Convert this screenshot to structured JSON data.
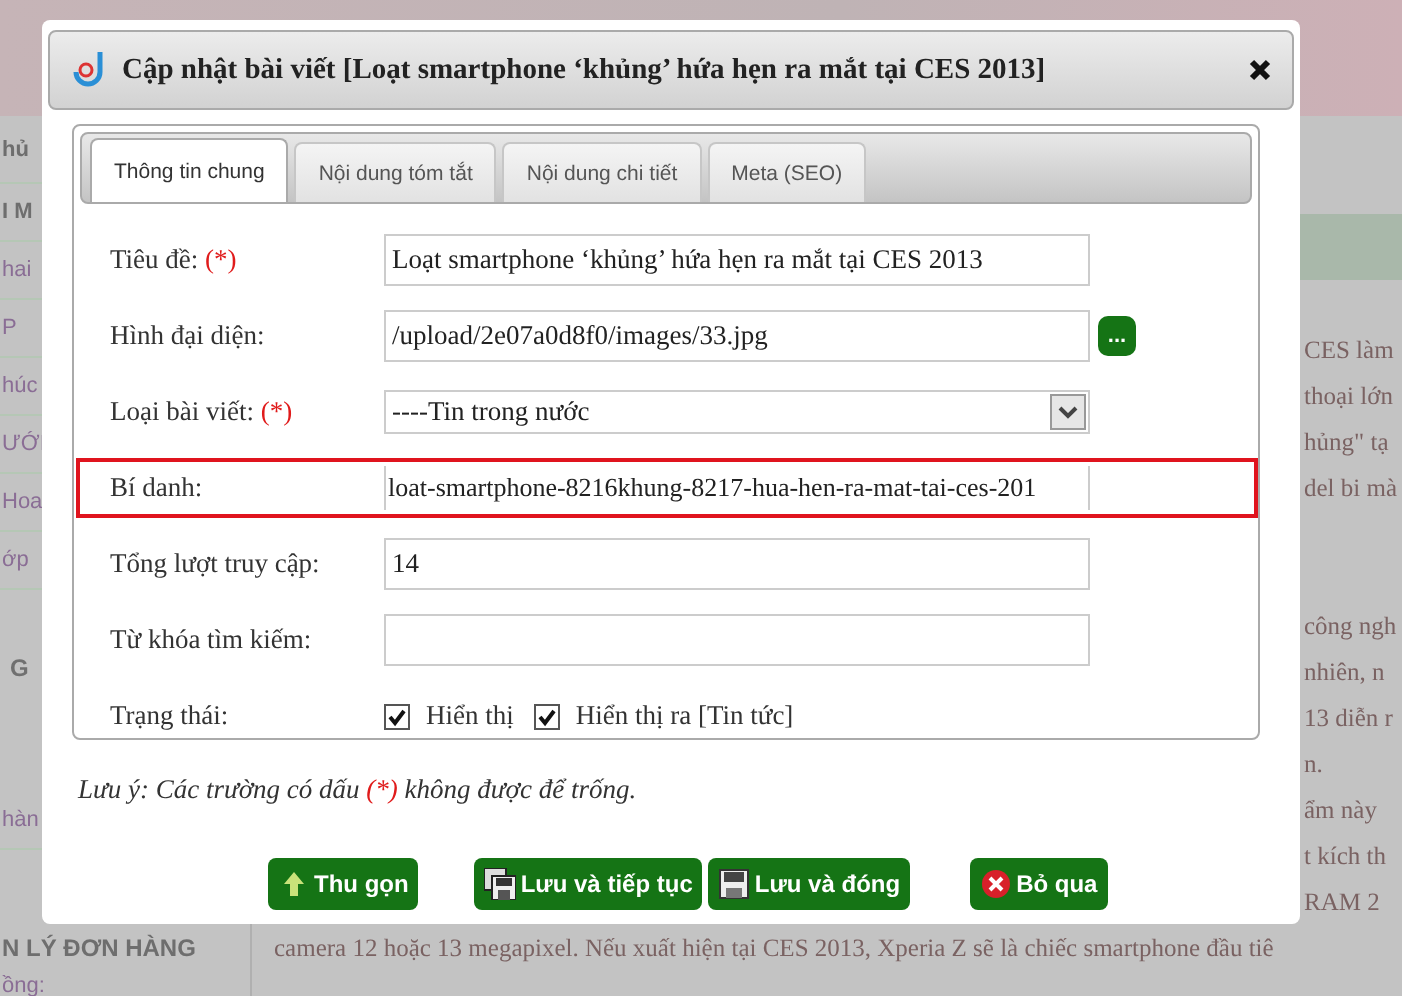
{
  "background": {
    "sidebar": [
      {
        "kind": "heading",
        "text": "hủ"
      },
      {
        "kind": "heading",
        "text": "I M"
      },
      {
        "kind": "link",
        "text": "hai"
      },
      {
        "kind": "link",
        "text": "P"
      },
      {
        "kind": "link",
        "text": "húc"
      },
      {
        "kind": "link",
        "text": "ƯỚI"
      },
      {
        "kind": "link",
        "text": "Hoa"
      },
      {
        "kind": "link",
        "text": "ớp"
      },
      {
        "kind": "section",
        "text": "G"
      },
      {
        "kind": "link",
        "text": "hàn"
      },
      {
        "kind": "heading",
        "text": "N LÝ ĐƠN HÀNG"
      },
      {
        "kind": "link",
        "text": "ồng:"
      }
    ],
    "paragraphs": [
      {
        "lines": [
          "CES làm",
          "thoại lớn",
          "hủng\" tạ",
          "del bi mà"
        ]
      },
      {
        "lines": [
          "công ngh",
          "nhiên, n",
          "13 diễn r",
          "n.",
          "ẩm này",
          "t kích th",
          "RAM 2"
        ]
      }
    ],
    "last_line": "camera 12 hoặc 13 megapixel. Nếu xuất hiện tại CES 2013, Xperia Z sẽ là chiếc smartphone đầu tiê"
  },
  "dialog": {
    "title": "Cập nhật bài viết [Loạt smartphone ‘khủng’ hứa hẹn ra mắt tại CES 2013]",
    "tabs": [
      {
        "label": "Thông tin chung",
        "selected": true
      },
      {
        "label": "Nội dung tóm tắt",
        "selected": false
      },
      {
        "label": "Nội dung chi tiết",
        "selected": false
      },
      {
        "label": "Meta (SEO)",
        "selected": false
      }
    ],
    "rows": [
      {
        "kind": "text",
        "label": "Tiêu đề:",
        "required_mark": "(*)",
        "value": "Loạt smartphone ‘khủng’ hứa hẹn ra mắt tại CES 2013",
        "highlighted": false
      },
      {
        "kind": "file",
        "label": "Hình đại diện:",
        "value": "/upload/2e07a0d8f0/images/33.jpg",
        "button": "...",
        "highlighted": false
      },
      {
        "kind": "select",
        "label": "Loại bài viết:",
        "required_mark": "(*)",
        "value": "----Tin trong nước",
        "highlighted": false
      },
      {
        "kind": "text",
        "label": "Bí danh:",
        "value": "loat-smartphone-8216khung-8217-hua-hen-ra-mat-tai-ces-201",
        "highlighted": true
      },
      {
        "kind": "text",
        "label": "Tổng lượt truy cập:",
        "value": "14",
        "highlighted": false
      },
      {
        "kind": "text",
        "label": "Từ khóa tìm kiếm:",
        "highlighted": false
      },
      {
        "kind": "checks",
        "label": "Trạng thái:",
        "options": [
          {
            "label": "Hiển thị",
            "checked": true
          },
          {
            "label": "Hiển thị ra [Tin tức]",
            "checked": true
          }
        ],
        "highlighted": false
      }
    ],
    "note": {
      "before": "Lưu ý: Các trường có dấu ",
      "mark": "(*)",
      "after": " không được để trống."
    },
    "buttons": [
      {
        "kind": "collapse",
        "label": "Thu gọn"
      },
      {
        "kind": "save_continue",
        "label": "Lưu và tiếp tục"
      },
      {
        "kind": "save_close",
        "label": "Lưu và đóng"
      },
      {
        "kind": "cancel",
        "label": "Bỏ qua"
      }
    ]
  }
}
